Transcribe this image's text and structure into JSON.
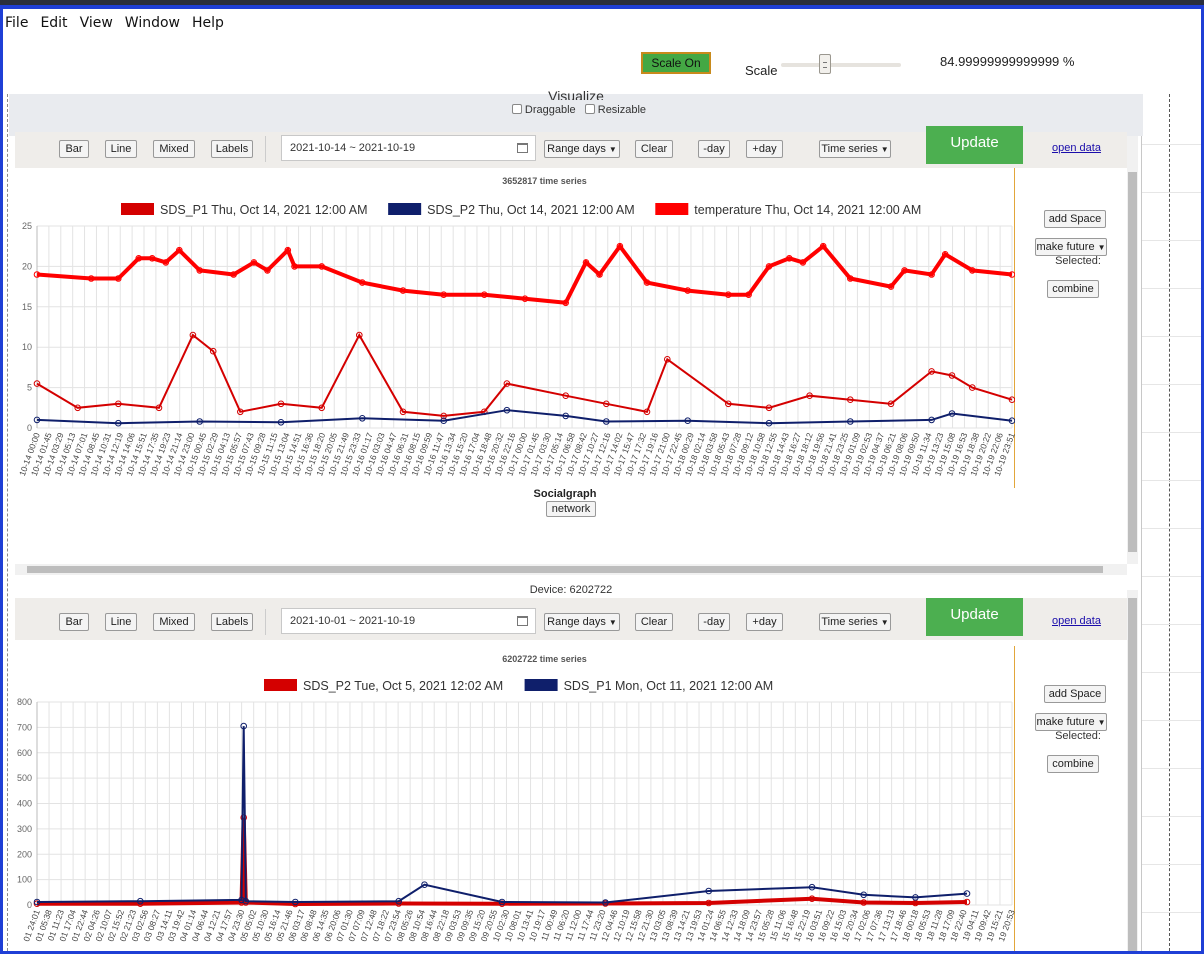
{
  "menu": {
    "items": [
      "File",
      "Edit",
      "View",
      "Window",
      "Help"
    ]
  },
  "scale": {
    "button": "Scale On",
    "label": "Scale",
    "value_text": "84.99999999999999 %",
    "slider_fraction": 0.35
  },
  "visualize": {
    "title": "Visualize",
    "draggable": "Draggable",
    "resizable": "Resizable"
  },
  "toolbar_labels": {
    "bar": "Bar",
    "line": "Line",
    "mixed": "Mixed",
    "labels": "Labels",
    "range": "Range days",
    "clear": "Clear",
    "minus_day": "-day",
    "plus_day": "+day",
    "mode": "Time series",
    "update": "Update",
    "open_data": "open data"
  },
  "side": {
    "add_space": "add Space",
    "make_future": "make future",
    "selected": "Selected:",
    "combine": "combine"
  },
  "panel1": {
    "date_range": "2021-10-14 ~ 2021-10-19",
    "socialgraph": "Socialgraph",
    "network": "network"
  },
  "device_label": "Device: 6202722",
  "panel2": {
    "date_range": "2021-10-01 ~ 2021-10-19"
  },
  "colors": {
    "series_red": "#d40000",
    "series_navy": "#0f1f6b",
    "series_bright_red": "#ff0000",
    "update_green": "#4caf50",
    "accent_border": "#e2a63a"
  },
  "chart_data": [
    {
      "type": "line",
      "title": "3652817 time series",
      "series": [
        {
          "name": "SDS_P1 Thu, Oct 14, 2021 12:00 AM",
          "color": "#d40000",
          "x": [
            "10-14 00:00",
            "10-14 06:00",
            "10-14 12:00",
            "10-14 18:00",
            "10-14 23:00",
            "10-15 02:00",
            "10-15 06:00",
            "10-15 12:00",
            "10-15 18:00",
            "10-15 23:33",
            "10-16 06:00",
            "10-16 12:00",
            "10-16 18:00",
            "10-16 21:20",
            "10-17 06:00",
            "10-17 12:00",
            "10-17 18:00",
            "10-17 21:00",
            "10-18 06:00",
            "10-18 12:00",
            "10-18 18:00",
            "10-19 00:00",
            "10-19 06:00",
            "10-19 12:00",
            "10-19 15:00",
            "10-19 18:00",
            "10-19 23:51"
          ],
          "values": [
            5.5,
            2.5,
            3,
            2.5,
            11.5,
            9.5,
            2,
            3,
            2.5,
            11.5,
            2,
            1.5,
            2,
            5.5,
            4,
            3,
            2,
            8.5,
            3,
            2.5,
            4,
            3.5,
            3,
            7,
            6.5,
            5,
            3.5
          ]
        },
        {
          "name": "SDS_P2 Thu, Oct 14, 2021 12:00 AM",
          "color": "#0f1f6b",
          "x": [
            "10-14 00:00",
            "10-14 12:00",
            "10-15 00:00",
            "10-15 12:00",
            "10-16 00:00",
            "10-16 12:00",
            "10-16 21:20",
            "10-17 06:00",
            "10-17 12:00",
            "10-18 00:00",
            "10-18 12:00",
            "10-19 00:00",
            "10-19 12:00",
            "10-19 15:00",
            "10-19 23:51"
          ],
          "values": [
            1,
            0.6,
            0.8,
            0.7,
            1.2,
            0.9,
            2.2,
            1.5,
            0.8,
            0.9,
            0.6,
            0.8,
            1,
            1.8,
            0.9
          ]
        },
        {
          "name": "temperature Thu, Oct 14, 2021 12:00 AM",
          "color": "#ff0000",
          "x": [
            "10-14 00:00",
            "10-14 08:00",
            "10-14 12:00",
            "10-14 15:00",
            "10-14 17:00",
            "10-14 19:00",
            "10-14 21:00",
            "10-15 00:00",
            "10-15 05:00",
            "10-15 08:00",
            "10-15 10:00",
            "10-15 13:00",
            "10-15 14:00",
            "10-15 18:00",
            "10-16 00:00",
            "10-16 06:00",
            "10-16 12:00",
            "10-16 18:00",
            "10-17 00:00",
            "10-17 06:00",
            "10-17 09:00",
            "10-17 11:00",
            "10-17 14:00",
            "10-17 18:00",
            "10-18 00:00",
            "10-18 06:00",
            "10-18 09:00",
            "10-18 12:00",
            "10-18 15:00",
            "10-18 17:00",
            "10-18 20:00",
            "10-19 00:00",
            "10-19 06:00",
            "10-19 08:00",
            "10-19 12:00",
            "10-19 14:00",
            "10-19 18:00",
            "10-19 23:51"
          ],
          "values": [
            19,
            18.5,
            18.5,
            21,
            21,
            20.5,
            22,
            19.5,
            19,
            20.5,
            19.5,
            22,
            20,
            20,
            18,
            17,
            16.5,
            16.5,
            16,
            15.5,
            20.5,
            19,
            22.5,
            18,
            17,
            16.5,
            16.5,
            20,
            21,
            20.5,
            22.5,
            18.5,
            17.5,
            19.5,
            19,
            21.5,
            19.5,
            19
          ]
        }
      ],
      "ylim": [
        0,
        25
      ],
      "yticks": [
        0,
        5,
        10,
        15,
        20,
        25
      ],
      "xlabel": "",
      "ylabel": "",
      "x_tick_labels": [
        "10-14 00:00",
        "10-14 01:45",
        "10-14 03:29",
        "10-14 05:13",
        "10-14 07:01",
        "10-14 08:45",
        "10-14 10:31",
        "10-14 12:19",
        "10-14 14:06",
        "10-14 15:51",
        "10-14 17:35",
        "10-14 19:23",
        "10-14 21:14",
        "10-14 23:00",
        "10-15 00:45",
        "10-15 02:29",
        "10-15 04:13",
        "10-15 05:57",
        "10-15 07:43",
        "10-15 09:28",
        "10-15 11:15",
        "10-15 13:04",
        "10-15 14:51",
        "10-15 16:36",
        "10-15 18:20",
        "10-15 20:05",
        "10-15 21:49",
        "10-15 23:33",
        "10-16 01:17",
        "10-16 03:03",
        "10-16 04:47",
        "10-16 06:31",
        "10-16 08:15",
        "10-16 09:59",
        "10-16 11:47",
        "10-16 13:34",
        "10-16 15:20",
        "10-16 17:04",
        "10-16 18:48",
        "10-16 20:32",
        "10-16 22:16",
        "10-17 00:00",
        "10-17 01:45",
        "10-17 03:30",
        "10-17 05:14",
        "10-17 06:58",
        "10-17 08:42",
        "10-17 10:27",
        "10-17 12:16",
        "10-17 14:02",
        "10-17 15:47",
        "10-17 17:32",
        "10-17 19:16",
        "10-17 21:00",
        "10-17 22:45",
        "10-18 00:29",
        "10-18 02:14",
        "10-18 03:58",
        "10-18 05:43",
        "10-18 07:28",
        "10-18 09:12",
        "10-18 10:58",
        "10-18 12:55",
        "10-18 14:43",
        "10-18 16:27",
        "10-18 18:12",
        "10-18 19:56",
        "10-18 21:41",
        "10-18 23:25",
        "10-19 01:09",
        "10-19 02:53",
        "10-19 04:37",
        "10-19 06:21",
        "10-19 08:06",
        "10-19 09:50",
        "10-19 11:34",
        "10-19 13:23",
        "10-19 15:08",
        "10-19 16:53",
        "10-19 18:38",
        "10-19 20:22",
        "10-19 22:06",
        "10-19 23:51"
      ],
      "grid": true,
      "legend": "top"
    },
    {
      "type": "line",
      "title": "6202722 time series",
      "series": [
        {
          "name": "SDS_P2 Tue, Oct 5, 2021 12:02 AM",
          "color": "#d40000",
          "x": [
            "10-01",
            "10-03",
            "10-04 23:00",
            "10-05 00:00",
            "10-05 01:00",
            "10-06",
            "10-08",
            "10-10",
            "10-12",
            "10-14",
            "10-16",
            "10-17",
            "10-18",
            "10-19"
          ],
          "values": [
            5,
            5,
            10,
            345,
            10,
            4,
            6,
            5,
            6,
            8,
            25,
            10,
            8,
            12
          ]
        },
        {
          "name": "SDS_P1 Mon, Oct 11, 2021 12:00 AM",
          "color": "#0f1f6b",
          "x": [
            "10-01",
            "10-03",
            "10-04 23:00",
            "10-05 00:00",
            "10-05 01:00",
            "10-06",
            "10-08",
            "10-08 12:00",
            "10-10",
            "10-12",
            "10-14",
            "10-16",
            "10-17",
            "10-18",
            "10-19"
          ],
          "values": [
            12,
            15,
            20,
            705,
            15,
            12,
            15,
            80,
            12,
            10,
            55,
            70,
            40,
            30,
            45
          ]
        }
      ],
      "ylim": [
        0,
        800
      ],
      "yticks": [
        0,
        100,
        200,
        300,
        400,
        500,
        600,
        700,
        800
      ],
      "xlabel": "",
      "ylabel": "",
      "x_tick_labels": [
        "01 24:01",
        "01 05:38",
        "01 11:23",
        "01 17:04",
        "01 22:44",
        "02 04:26",
        "02 10:07",
        "02 15:52",
        "02 21:23",
        "03 02:56",
        "03 08:27",
        "03 14:11",
        "03 19:42",
        "04 01:14",
        "04 06:44",
        "04 12:21",
        "04 17:57",
        "04 23:30",
        "05 05:02",
        "05 10:30",
        "05 16:14",
        "05 21:46",
        "06 03:17",
        "06 08:48",
        "06 14:35",
        "06 20:06",
        "07 01:30",
        "07 07:09",
        "07 12:48",
        "07 18:22",
        "07 23:54",
        "08 05:26",
        "08 10:54",
        "08 16:44",
        "08 22:18",
        "09 03:53",
        "09 09:35",
        "09 15:20",
        "09 20:55",
        "10 02:30",
        "10 08:01",
        "10 13:41",
        "10 19:17",
        "11 00:49",
        "11 06:20",
        "11 12:00",
        "11 17:44",
        "11 23:20",
        "12 04:46",
        "12 10:19",
        "12 15:58",
        "12 21:30",
        "13 03:05",
        "13 08:39",
        "13 14:21",
        "13 19:53",
        "14 01:24",
        "14 06:55",
        "14 12:33",
        "14 18:09",
        "14 23:57",
        "15 05:28",
        "15 11:06",
        "15 16:48",
        "15 22:19",
        "16 03:51",
        "16 09:22",
        "16 15:03",
        "16 20:34",
        "17 02:06",
        "17 07:36",
        "17 13:13",
        "17 18:46",
        "18 00:18",
        "18 05:53",
        "18 11:28",
        "18 17:09",
        "18 22:40",
        "19 04:11",
        "19 09:42",
        "19 15:21",
        "19 20:53"
      ],
      "grid": true,
      "legend": "top"
    }
  ]
}
